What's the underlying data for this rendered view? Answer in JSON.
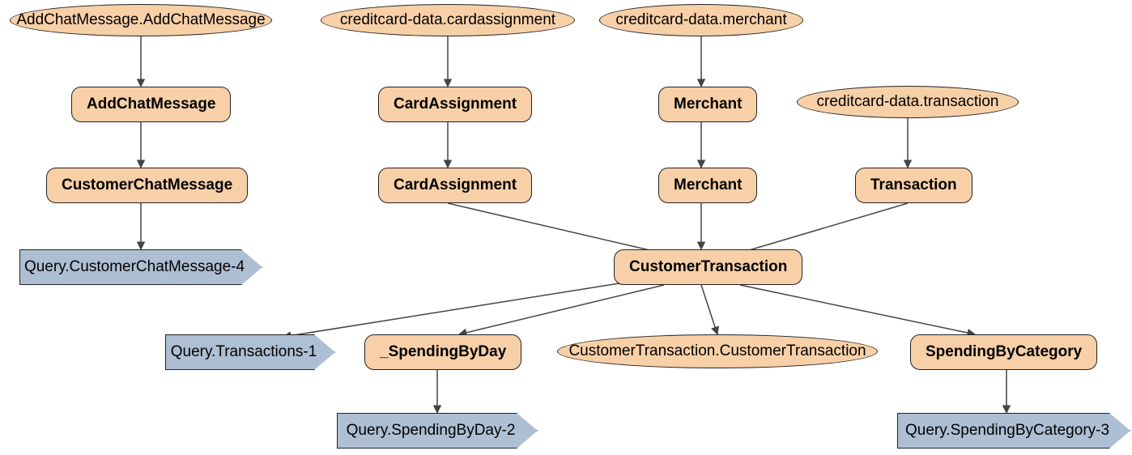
{
  "nodes": {
    "e1": {
      "label": "AddChatMessage.AddChatMessage"
    },
    "e2": {
      "label": "creditcard-data.cardassignment"
    },
    "e3": {
      "label": "creditcard-data.merchant"
    },
    "e4": {
      "label": "creditcard-data.transaction"
    },
    "e5": {
      "label": "CustomerTransaction.CustomerTransaction"
    },
    "r1": {
      "label": "AddChatMessage"
    },
    "r2": {
      "label": "CustomerChatMessage"
    },
    "r3a": {
      "label": "CardAssignment"
    },
    "r3b": {
      "label": "CardAssignment"
    },
    "r4a": {
      "label": "Merchant"
    },
    "r4b": {
      "label": "Merchant"
    },
    "r5": {
      "label": "Transaction"
    },
    "r6": {
      "label": "CustomerTransaction"
    },
    "r7": {
      "label": "_SpendingByDay"
    },
    "r8": {
      "label": "SpendingByCategory"
    },
    "a1": {
      "label": "Query.CustomerChatMessage-4"
    },
    "a2": {
      "label": "Query.Transactions-1"
    },
    "a3": {
      "label": "Query.SpendingByDay-2"
    },
    "a4": {
      "label": "Query.SpendingByCategory-3"
    }
  },
  "colors": {
    "node_fill": "#f8d0a8",
    "sink_fill": "#aebfd4",
    "edge": "#444444"
  }
}
